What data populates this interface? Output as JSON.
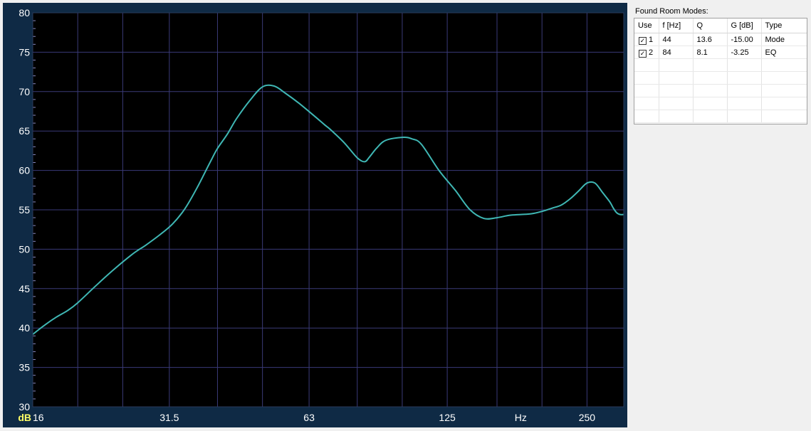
{
  "chart_data": {
    "type": "line",
    "x_scale": "log",
    "xlim": [
      16,
      300
    ],
    "ylim": [
      30,
      80
    ],
    "y_ticks": [
      30,
      35,
      40,
      45,
      50,
      55,
      60,
      65,
      70,
      75,
      80
    ],
    "x_tick_labels": [
      {
        "value": 16,
        "label": "16"
      },
      {
        "value": 31.5,
        "label": "31.5"
      },
      {
        "value": 63,
        "label": "63"
      },
      {
        "value": 125,
        "label": "125"
      },
      {
        "value": 250,
        "label": "250"
      }
    ],
    "x_gridlines": [
      16,
      20,
      25,
      31.5,
      40,
      50,
      63,
      80,
      100,
      125,
      160,
      200,
      250,
      300
    ],
    "ylabel": "dB",
    "xlabel": "Hz",
    "xlabel_at": 180,
    "grid": true,
    "colors": {
      "background": "#000000",
      "grid": "#3a3a78",
      "line": "#3fb7b4",
      "frame": "#0f2a45",
      "tick_text": "#ffffff",
      "ylabel_text": "#ffff66"
    },
    "series": [
      {
        "x": [
          16,
          17,
          18,
          19,
          20,
          22,
          24,
          26,
          27,
          28,
          30,
          32,
          34,
          36,
          38,
          39,
          40,
          42,
          44,
          47,
          50,
          53,
          56,
          60,
          65,
          68,
          70,
          75,
          80,
          83,
          85,
          88,
          92,
          100,
          105,
          110,
          120,
          130,
          140,
          150,
          160,
          170,
          180,
          190,
          200,
          210,
          220,
          230,
          240,
          250,
          260,
          270,
          280,
          285,
          290,
          295,
          300
        ],
        "y": [
          39.2,
          40.4,
          41.4,
          42.2,
          43.2,
          45.5,
          47.5,
          49.2,
          49.9,
          50.5,
          51.8,
          53.2,
          55.1,
          57.6,
          60.3,
          61.6,
          62.8,
          64.6,
          66.6,
          68.9,
          70.6,
          70.7,
          69.8,
          68.5,
          66.8,
          65.8,
          65.2,
          63.5,
          61.6,
          61.1,
          61.7,
          62.8,
          63.8,
          64.2,
          64.0,
          63.3,
          60.0,
          57.5,
          55.0,
          53.9,
          54.0,
          54.3,
          54.4,
          54.5,
          54.8,
          55.2,
          55.6,
          56.4,
          57.4,
          58.4,
          58.4,
          57.2,
          56.0,
          55.2,
          54.6,
          54.4,
          54.4
        ]
      }
    ]
  },
  "modes_panel": {
    "title": "Found Room Modes:",
    "columns": [
      "Use",
      "f [Hz]",
      "Q",
      "G [dB]",
      "Type"
    ],
    "rows": [
      {
        "checked": true,
        "use": "1",
        "f": "44",
        "q": "13.6",
        "g": "-15.00",
        "type": "Mode"
      },
      {
        "checked": true,
        "use": "2",
        "f": "84",
        "q": "8.1",
        "g": "-3.25",
        "type": "EQ"
      }
    ],
    "empty_rows": 5
  }
}
